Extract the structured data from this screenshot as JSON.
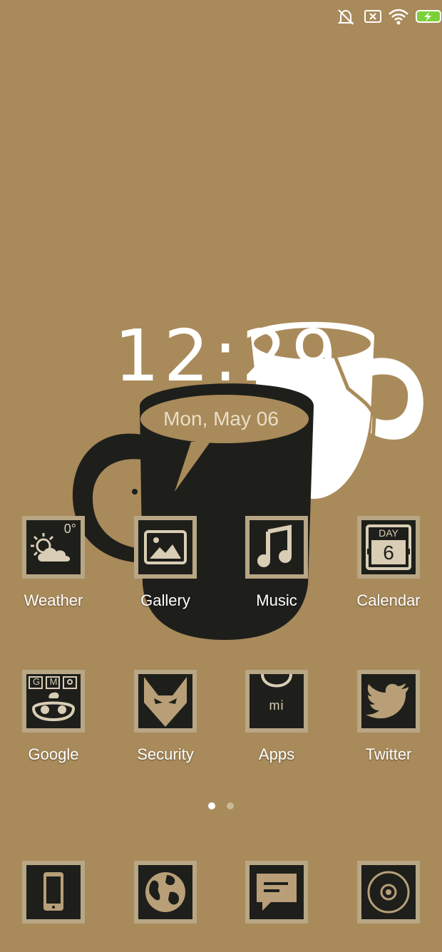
{
  "status_bar": {
    "icons": [
      "mute-bell-icon",
      "no-sim-icon",
      "wifi-icon",
      "battery-charging-icon"
    ]
  },
  "wallpaper": {
    "description_icon": "coffee-mugs-wallpaper"
  },
  "clock": {
    "hours": "12",
    "separator": ":",
    "minutes": "29"
  },
  "date": "Mon, May 06",
  "weather_tile": {
    "temperature": "0°"
  },
  "calendar_tile": {
    "day_label": "DAY",
    "day_number": "6"
  },
  "apps_row1": [
    {
      "label": "Weather",
      "icon": "weather-icon"
    },
    {
      "label": "Gallery",
      "icon": "gallery-icon"
    },
    {
      "label": "Music",
      "icon": "music-note-icon"
    },
    {
      "label": "Calendar",
      "icon": "calendar-icon"
    }
  ],
  "apps_row2": [
    {
      "label": "Google",
      "icon": "google-icon"
    },
    {
      "label": "Security",
      "icon": "security-fox-icon"
    },
    {
      "label": "Apps",
      "icon": "mi-bag-icon"
    },
    {
      "label": "Twitter",
      "icon": "twitter-bird-icon"
    }
  ],
  "google_tile": {
    "letters": [
      "G",
      "M"
    ]
  },
  "apps_tile": {
    "brand": "mi"
  },
  "page_indicator": {
    "pages": 2,
    "current": 1
  },
  "dock": [
    {
      "icon": "phone-icon"
    },
    {
      "icon": "browser-globe-icon"
    },
    {
      "icon": "messaging-icon"
    },
    {
      "icon": "camera-icon"
    }
  ],
  "colors": {
    "background": "#A98A5A",
    "tile": "#1E1F1B",
    "tile_border": "#B8A685",
    "glyph": "#B89F78",
    "battery": "#7BD13A"
  }
}
